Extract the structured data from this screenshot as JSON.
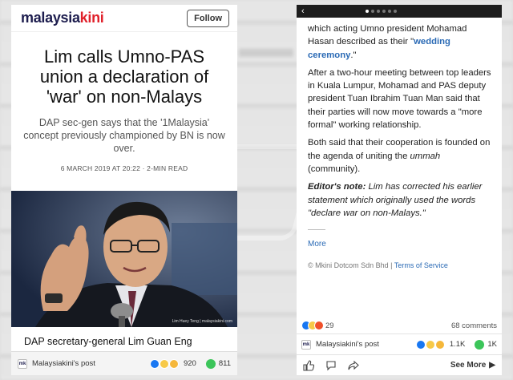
{
  "left": {
    "logo_part1": "malaysia",
    "logo_part2": "kini",
    "follow_label": "Follow",
    "headline": "Lim calls Umno-PAS union a declaration of 'war' on non-Malays",
    "subhead": "DAP sec-gen says that the '1Malaysia' concept previously championed by BN is now over.",
    "date": "6 MARCH 2019 AT 20:22",
    "read_time": "2-MIN READ",
    "photo_credit": "Lim Huey Teng | malaysiakini.com",
    "caption_start": "DAP secretary-general Lim Guan Eng",
    "poster": "Malaysiakini's post",
    "reactions_count": "920",
    "comments_count": "811"
  },
  "right": {
    "para1_pre": "which acting Umno president Mohamad Hasan described as their \"",
    "para1_link": "wedding ceremony",
    "para1_post": ".\"",
    "para2": "After a two-hour meeting between top leaders in Kuala Lumpur, Mohamad and PAS deputy president Tuan Ibrahim Tuan Man said that their parties will now move towards a \"more formal\" working relationship.",
    "para3_pre": "Both said that their cooperation is founded on the agenda of uniting the ",
    "para3_italic": "ummah",
    "para3_post": " (community).",
    "editor_label": "Editor's note:",
    "editor_text": " Lim has corrected his earlier statement which originally used the words \"declare war on non-Malays.\"",
    "more_label": "More",
    "copyright": "© Mkini Dotcom Sdn Bhd |",
    "tos": "Terms of Service",
    "reactions_count": "29",
    "comments_label": "68 comments",
    "poster": "Malaysiakini's post",
    "poster_reacts": "1.1K",
    "poster_comments": "1K",
    "see_more": "See More"
  },
  "colors": {
    "brand_navy": "#1d1d4e",
    "brand_red": "#e0202a",
    "link_blue": "#2a6ab5",
    "like_blue": "#1877f2"
  }
}
